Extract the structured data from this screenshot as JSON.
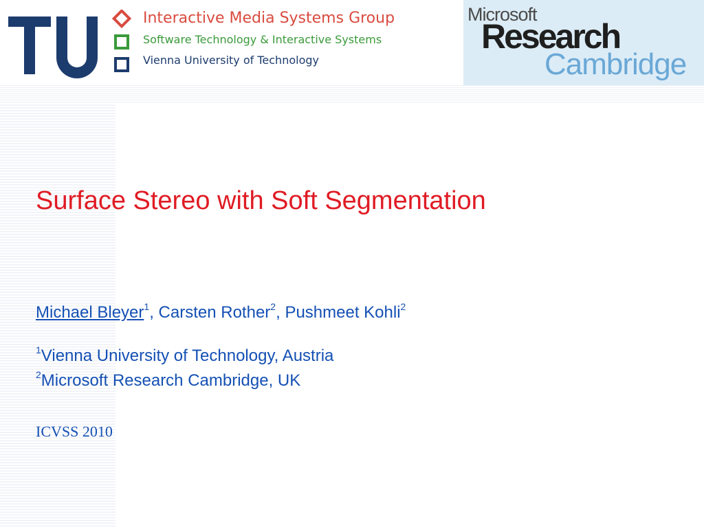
{
  "header": {
    "tu_logo_text": "TU",
    "group_lines": [
      "Interactive Media Systems Group",
      "Software Technology & Interactive Systems",
      "Vienna University of Technology"
    ],
    "ms_logo": {
      "microsoft": "Microsoft",
      "research": "Research",
      "cambridge": "Cambridge"
    },
    "colors": {
      "tu_blue": "#1d3c6e",
      "group_red": "#d94b3f",
      "group_green": "#3a9a3a",
      "ms_box_bg": "#dcecf6"
    }
  },
  "slide": {
    "title": "Surface Stereo with Soft Segmentation",
    "authors": [
      {
        "name": "Michael Bleyer",
        "sup": "1",
        "link": true
      },
      {
        "name": "Carsten Rother",
        "sup": "2",
        "link": false
      },
      {
        "name": "Pushmeet Kohli",
        "sup": "2",
        "link": false
      }
    ],
    "author_separator": ", ",
    "affiliations": [
      {
        "sup": "1",
        "text": "Vienna University of Technology, Austria"
      },
      {
        "sup": "2",
        "text": "Microsoft Research Cambridge, UK"
      }
    ],
    "event": "ICVSS 2010",
    "colors": {
      "title": "#e01b24",
      "body": "#1450b4"
    }
  }
}
